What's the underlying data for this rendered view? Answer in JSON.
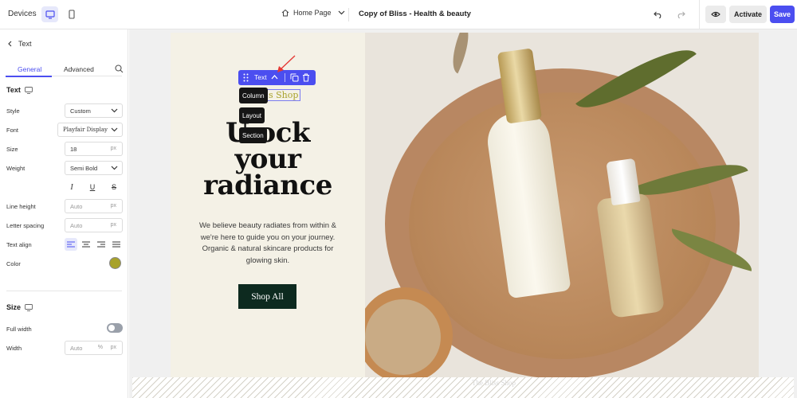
{
  "topbar": {
    "devices_label": "Devices",
    "page_selector": "Home Page",
    "site_title": "Copy of Bliss - Health & beauty",
    "activate_label": "Activate",
    "save_label": "Save"
  },
  "panel": {
    "back_label": "Text",
    "tabs": [
      "General",
      "Advanced"
    ],
    "text_section": "Text",
    "fields": {
      "style": {
        "label": "Style",
        "value": "Custom"
      },
      "font": {
        "label": "Font",
        "value": "Playfair Display"
      },
      "size": {
        "label": "Size",
        "value": "18",
        "unit": "px"
      },
      "weight": {
        "label": "Weight",
        "value": "Semi Bold"
      },
      "line_height": {
        "label": "Line height",
        "placeholder": "Auto",
        "unit": "px"
      },
      "letter_spacing": {
        "label": "Letter spacing",
        "placeholder": "Auto",
        "unit": "px"
      },
      "text_align": {
        "label": "Text align",
        "selected": "left"
      },
      "color": {
        "label": "Color",
        "value": "#a8a22a"
      }
    },
    "size_section": "Size",
    "full_width": {
      "label": "Full width",
      "on": false
    },
    "width": {
      "label": "Width",
      "placeholder": "Auto",
      "units": [
        "%",
        "px"
      ]
    }
  },
  "canvas": {
    "toolbar": {
      "label": "Text",
      "breadcrumbs": [
        "Column",
        "Layout",
        "Section"
      ]
    },
    "hero": {
      "tagline_visible": "s Shop",
      "title": "Unlock your radiance",
      "title_visible": "U    ock your radiance",
      "body": "We believe beauty radiates from within & we're here to guide you on your journey. Organic & natural skincare products for glowing skin.",
      "button_label": "Shop All"
    },
    "footer_strip_text": "The Bliss Shop"
  },
  "colors": {
    "accent": "#4b4ef0",
    "hero_bg": "#f4f1e6",
    "button_bg": "#0d2a1f",
    "text_color_swatch": "#a8a22a"
  }
}
